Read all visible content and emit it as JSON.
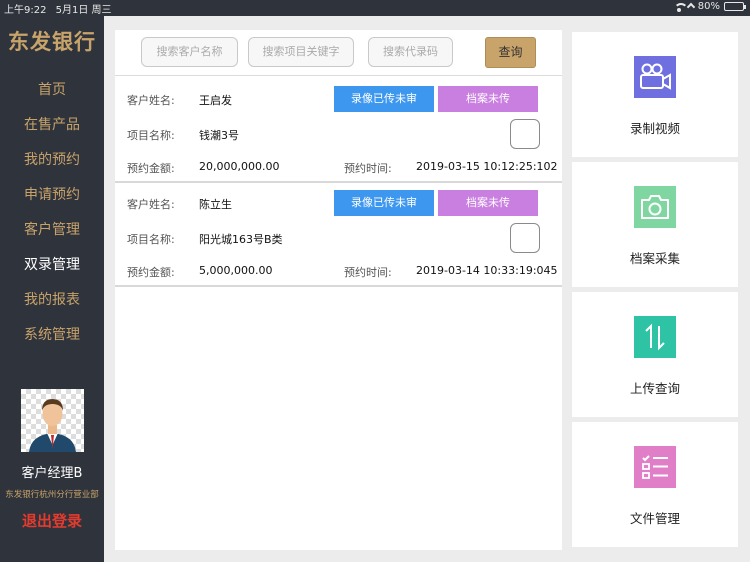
{
  "status_bar": {
    "time": "上午9:22",
    "date": "5月1日 周三",
    "battery": "80%"
  },
  "sidebar": {
    "logo": "东发银行",
    "items": [
      {
        "label": "首页"
      },
      {
        "label": "在售产品"
      },
      {
        "label": "我的预约"
      },
      {
        "label": "申请预约"
      },
      {
        "label": "客户管理"
      },
      {
        "label": "双录管理",
        "active": true
      },
      {
        "label": "我的报表"
      },
      {
        "label": "系统管理"
      }
    ],
    "user": {
      "name": "客户经理B",
      "department": "东发银行杭州分行营业部"
    },
    "logout": "退出登录"
  },
  "search": {
    "customer_placeholder": "搜索客户名称",
    "project_placeholder": "搜索项目关键字",
    "code_placeholder": "搜索代录码",
    "query_button": "查询"
  },
  "records": [
    {
      "customer_label": "客户姓名:",
      "customer_name": "王启发",
      "project_label": "项目名称:",
      "project_name": "钱潮3号",
      "amount_label": "预约金额:",
      "amount": "20,000,000.00",
      "time_label": "预约时间:",
      "time": "2019-03-15 10:12:25:102",
      "video_status": "录像已传未审",
      "archive_status": "档案未传"
    },
    {
      "customer_label": "客户姓名:",
      "customer_name": "陈立生",
      "project_label": "项目名称:",
      "project_name": "阳光城163号B类",
      "amount_label": "预约金额:",
      "amount": "5,000,000.00",
      "time_label": "预约时间:",
      "time": "2019-03-14 10:33:19:045",
      "video_status": "录像已传未审",
      "archive_status": "档案未传"
    }
  ],
  "actions": [
    {
      "label": "录制视频",
      "icon": "video-camera-icon",
      "color": "#6f6fe0"
    },
    {
      "label": "档案采集",
      "icon": "camera-icon",
      "color": "#7fd6a0"
    },
    {
      "label": "上传查询",
      "icon": "upload-arrows-icon",
      "color": "#2fc3a6"
    },
    {
      "label": "文件管理",
      "icon": "checklist-icon",
      "color": "#e07fc8"
    }
  ],
  "colors": {
    "sidebar_bg": "#2f333c",
    "accent_gold": "#c8a36a",
    "badge_blue": "#3d97ef",
    "badge_purple": "#c97fe0",
    "logout_red": "#e53b2f"
  }
}
